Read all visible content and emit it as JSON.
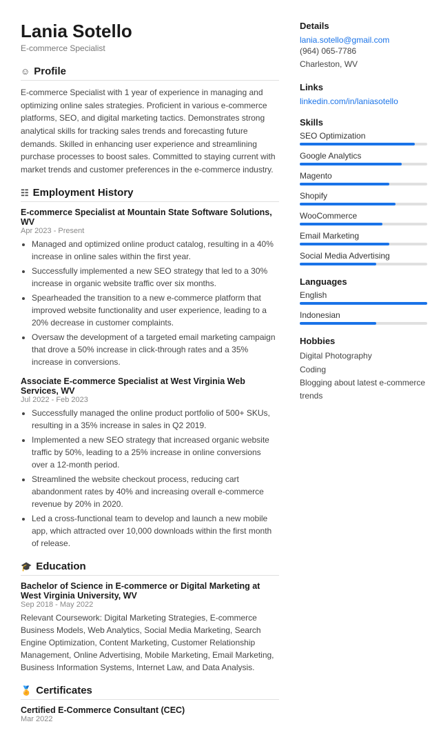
{
  "header": {
    "name": "Lania Sotello",
    "title": "E-commerce Specialist"
  },
  "sections": {
    "profile": {
      "label": "Profile",
      "icon": "👤",
      "text": "E-commerce Specialist with 1 year of experience in managing and optimizing online sales strategies. Proficient in various e-commerce platforms, SEO, and digital marketing tactics. Demonstrates strong analytical skills for tracking sales trends and forecasting future demands. Skilled in enhancing user experience and streamlining purchase processes to boost sales. Committed to staying current with market trends and customer preferences in the e-commerce industry."
    },
    "employment": {
      "label": "Employment History",
      "icon": "🏢",
      "jobs": [
        {
          "title": "E-commerce Specialist at Mountain State Software Solutions, WV",
          "dates": "Apr 2023 - Present",
          "bullets": [
            "Managed and optimized online product catalog, resulting in a 40% increase in online sales within the first year.",
            "Successfully implemented a new SEO strategy that led to a 30% increase in organic website traffic over six months.",
            "Spearheaded the transition to a new e-commerce platform that improved website functionality and user experience, leading to a 20% decrease in customer complaints.",
            "Oversaw the development of a targeted email marketing campaign that drove a 50% increase in click-through rates and a 35% increase in conversions."
          ]
        },
        {
          "title": "Associate E-commerce Specialist at West Virginia Web Services, WV",
          "dates": "Jul 2022 - Feb 2023",
          "bullets": [
            "Successfully managed the online product portfolio of 500+ SKUs, resulting in a 35% increase in sales in Q2 2019.",
            "Implemented a new SEO strategy that increased organic website traffic by 50%, leading to a 25% increase in online conversions over a 12-month period.",
            "Streamlined the website checkout process, reducing cart abandonment rates by 40% and increasing overall e-commerce revenue by 20% in 2020.",
            "Led a cross-functional team to develop and launch a new mobile app, which attracted over 10,000 downloads within the first month of release."
          ]
        }
      ]
    },
    "education": {
      "label": "Education",
      "icon": "🎓",
      "items": [
        {
          "title": "Bachelor of Science in E-commerce or Digital Marketing at West Virginia University, WV",
          "dates": "Sep 2018 - May 2022",
          "text": "Relevant Coursework: Digital Marketing Strategies, E-commerce Business Models, Web Analytics, Social Media Marketing, Search Engine Optimization, Content Marketing, Customer Relationship Management, Online Advertising, Mobile Marketing, Email Marketing, Business Information Systems, Internet Law, and Data Analysis."
        }
      ]
    },
    "certificates": {
      "label": "Certificates",
      "icon": "🏅",
      "items": [
        {
          "title": "Certified E-Commerce Consultant (CEC)",
          "dates": "Mar 2022"
        }
      ]
    }
  },
  "sidebar": {
    "details": {
      "label": "Details",
      "email": "lania.sotello@gmail.com",
      "phone": "(964) 065-7786",
      "location": "Charleston, WV"
    },
    "links": {
      "label": "Links",
      "items": [
        {
          "text": "linkedin.com/in/laniasotello",
          "url": "#"
        }
      ]
    },
    "skills": {
      "label": "Skills",
      "items": [
        {
          "name": "SEO Optimization",
          "level": 90
        },
        {
          "name": "Google Analytics",
          "level": 80
        },
        {
          "name": "Magento",
          "level": 70
        },
        {
          "name": "Shopify",
          "level": 75
        },
        {
          "name": "WooCommerce",
          "level": 65
        },
        {
          "name": "Email Marketing",
          "level": 70
        },
        {
          "name": "Social Media Advertising",
          "level": 60
        }
      ]
    },
    "languages": {
      "label": "Languages",
      "items": [
        {
          "name": "English",
          "level": 100
        },
        {
          "name": "Indonesian",
          "level": 60
        }
      ]
    },
    "hobbies": {
      "label": "Hobbies",
      "items": [
        "Digital Photography",
        "Coding",
        "Blogging about latest e-commerce trends"
      ]
    }
  }
}
